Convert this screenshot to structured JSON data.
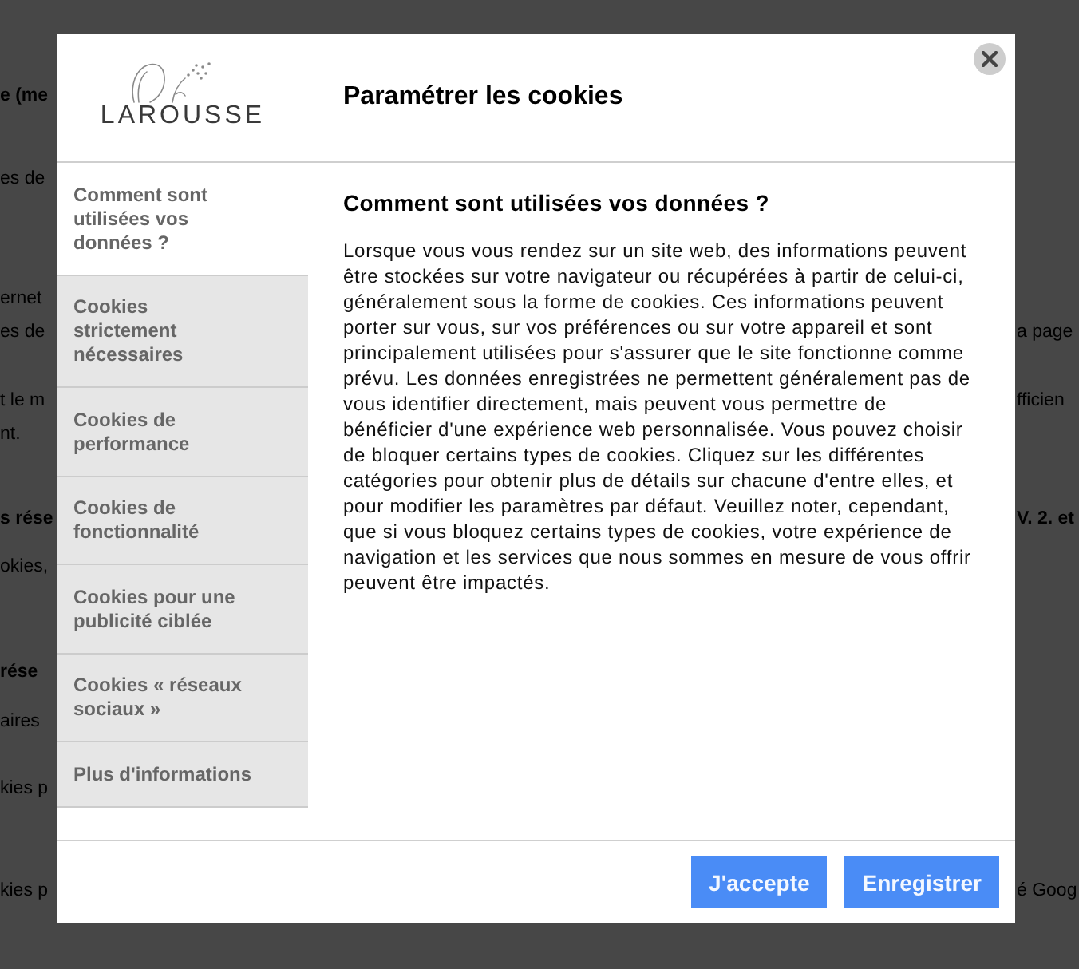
{
  "background_page": {
    "lines": [
      {
        "kind": "heading",
        "left": "e (me"
      },
      {
        "kind": "text",
        "left": "es de"
      },
      {
        "kind": "text",
        "left": "ernet"
      },
      {
        "kind": "text",
        "left": "es de",
        "right": "a page"
      },
      {
        "kind": "text",
        "left": "t le m",
        "right": "fficien"
      },
      {
        "kind": "text",
        "left": "nt."
      },
      {
        "kind": "heading",
        "left": "s rése",
        "right": "V. 2. et"
      },
      {
        "kind": "text",
        "left": "okies,"
      },
      {
        "kind": "heading",
        "left": "rése"
      },
      {
        "kind": "text",
        "left": "aires"
      },
      {
        "kind": "text",
        "left": "kies p"
      },
      {
        "kind": "text",
        "left": "kies p",
        "right": "é Goog"
      }
    ]
  },
  "dialog": {
    "logo": {
      "text": "LAROUSSE"
    },
    "title": "Paramétrer les cookies"
  },
  "sidebar": {
    "items": [
      {
        "label": "Comment sont utilisées vos données ?",
        "selected": true
      },
      {
        "label": "Cookies strictement nécessaires",
        "selected": false
      },
      {
        "label": "Cookies de performance",
        "selected": false
      },
      {
        "label": "Cookies de fonctionnalité",
        "selected": false
      },
      {
        "label": "Cookies pour une publicité ciblée",
        "selected": false
      },
      {
        "label": "Cookies « réseaux sociaux »",
        "selected": false
      },
      {
        "label": "Plus d'informations",
        "selected": false
      }
    ]
  },
  "content": {
    "heading": "Comment sont utilisées vos données ?",
    "paragraph": "Lorsque vous vous rendez sur un site web, des informations peuvent être stockées sur votre navigateur ou récupérées à partir de celui-ci, généralement sous la forme de cookies. Ces informations peuvent porter sur vous, sur vos préférences ou sur votre appareil et sont principalement utilisées pour s'assurer que le site fonctionne comme prévu. Les données enregistrées ne permettent généralement pas de vous identifier directement, mais peuvent vous permettre de bénéficier d'une expérience web personnalisée. Vous pouvez choisir de bloquer certains types de cookies. Cliquez sur les différentes catégories pour obtenir plus de détails sur chacune d'entre elles, et pour modifier les paramètres par défaut. Veuillez noter, cependant, que si vous bloquez certains types de cookies, votre expérience de navigation et les services que nous sommes en mesure de vous offrir peuvent être impactés."
  },
  "buttons": [
    {
      "label": "J'accepte"
    },
    {
      "label": "Enregistrer"
    }
  ]
}
